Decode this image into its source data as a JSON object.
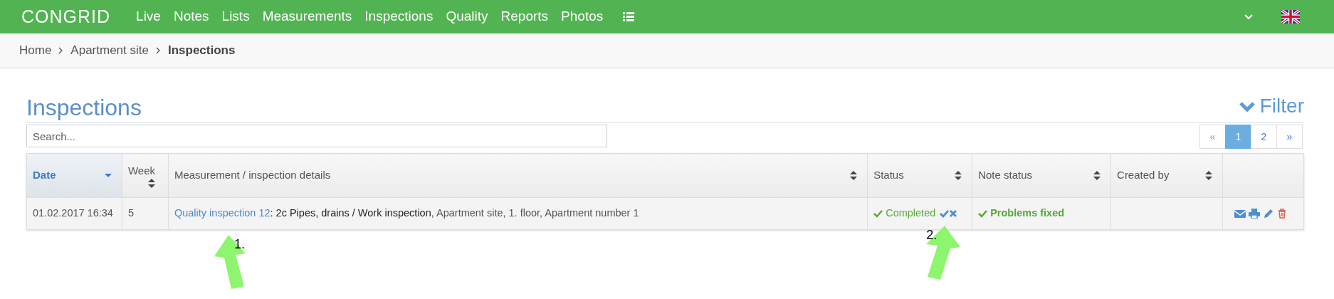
{
  "navbar": {
    "logo": "CONGRID",
    "menu": [
      {
        "label": "Live"
      },
      {
        "label": "Notes"
      },
      {
        "label": "Lists"
      },
      {
        "label": "Measurements"
      },
      {
        "label": "Inspections"
      },
      {
        "label": "Quality"
      },
      {
        "label": "Reports"
      },
      {
        "label": "Photos"
      }
    ]
  },
  "breadcrumb": [
    {
      "label": "Home",
      "current": false
    },
    {
      "label": "Apartment site",
      "current": false
    },
    {
      "label": "Inspections",
      "current": true
    }
  ],
  "page_title": "Inspections",
  "filter": {
    "label": "Filter",
    "expanded": false
  },
  "search": {
    "placeholder": "Search..."
  },
  "pagination": [
    {
      "label": "«",
      "selected": false
    },
    {
      "label": "1",
      "selected": true
    },
    {
      "label": "2",
      "selected": false
    },
    {
      "label": "»",
      "selected": false
    }
  ],
  "table": {
    "columns": [
      {
        "label": "Date",
        "sortable": true,
        "selected": true
      },
      {
        "label": "Week",
        "sortable": true,
        "selected": false
      },
      {
        "label": "Measurement / inspection details",
        "sortable": true,
        "selected": false
      },
      {
        "label": "Status",
        "sortable": true,
        "selected": false
      },
      {
        "label": "Note status",
        "sortable": true,
        "selected": false
      },
      {
        "label": "Created by",
        "sortable": true,
        "selected": false
      },
      {
        "sortable": false,
        "selected": false
      }
    ],
    "rows": [
      {
        "date": "01.02.2017 16:34",
        "week": "5",
        "link": "Quality inspection 12",
        "title": ": 2c Pipes, drains / Work inspection",
        "location": ", Apartment site, 1. floor, Apartment number 1",
        "status": "Completed",
        "note_status": "Problems fixed"
      }
    ]
  },
  "annotations": [
    {
      "label": "1."
    },
    {
      "label": "2."
    }
  ]
}
